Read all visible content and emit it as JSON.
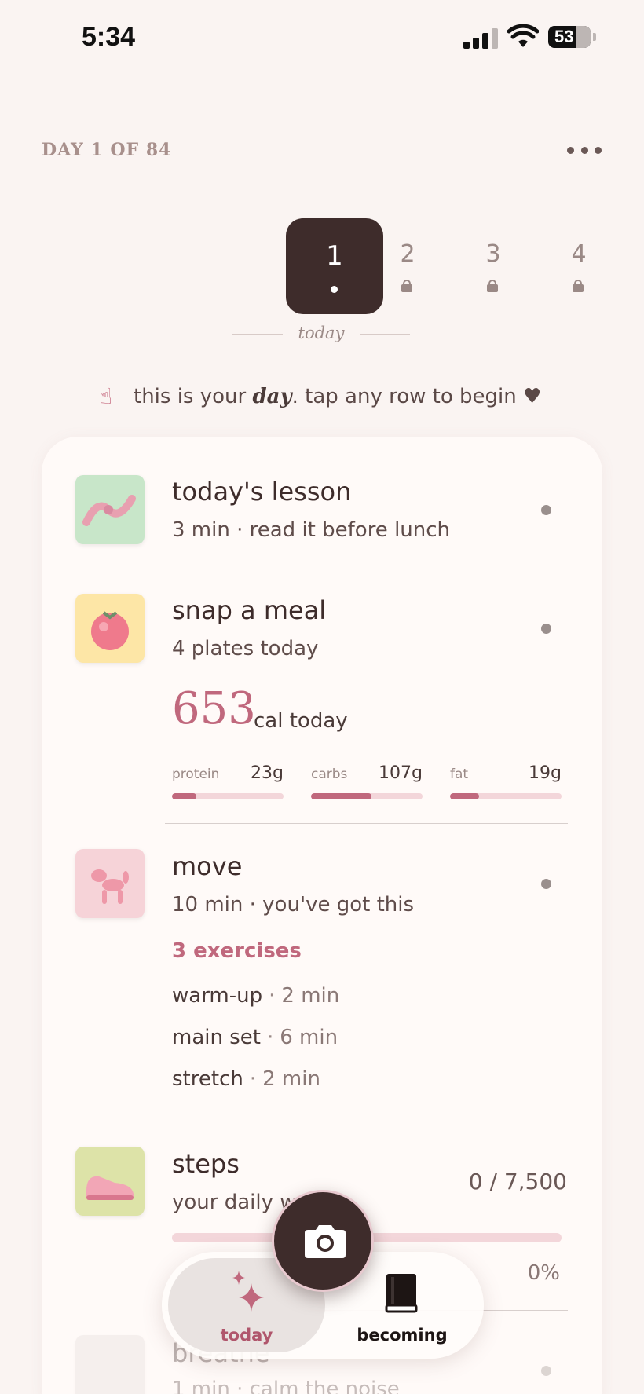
{
  "status_bar": {
    "time": "5:34",
    "battery": "53"
  },
  "header": {
    "day_label": "DAY 1 OF 84"
  },
  "days": [
    {
      "number": "1",
      "state": "active"
    },
    {
      "number": "2",
      "state": "locked"
    },
    {
      "number": "3",
      "state": "locked"
    },
    {
      "number": "4",
      "state": "locked"
    }
  ],
  "today_caption": "today",
  "hint": {
    "before": "this is your",
    "emphasis": "day",
    "after": ". tap any row to begin ♥"
  },
  "rows": {
    "lesson": {
      "title": "today's lesson",
      "subtitle": "3 min · read it before lunch",
      "icon": "bow-icon"
    },
    "meal": {
      "title": "snap a meal",
      "subtitle": "4 plates today",
      "icon": "tomato-icon",
      "calories": "653",
      "calories_unit": "cal today",
      "macros": [
        {
          "label": "protein",
          "value": "23g",
          "progress": 0.22
        },
        {
          "label": "carbs",
          "value": "107g",
          "progress": 0.54
        },
        {
          "label": "fat",
          "value": "19g",
          "progress": 0.26
        }
      ]
    },
    "move": {
      "title": "move",
      "subtitle": "10 min · you've got this",
      "icon": "balloon-dog-icon",
      "exercise_count": "3 exercises",
      "exercises": [
        {
          "name": "warm-up",
          "duration": "2 min"
        },
        {
          "name": "main set",
          "duration": "6 min"
        },
        {
          "name": "stretch",
          "duration": "2 min"
        }
      ]
    },
    "steps": {
      "title": "steps",
      "subtitle": "your daily w",
      "icon": "shoe-icon",
      "count": "0 / 7,500",
      "percent": "0%",
      "progress": 0
    },
    "breathe": {
      "title": "breathe",
      "subtitle": "1 min · calm the noise"
    }
  },
  "nav": {
    "today_label": "today",
    "becoming_label": "becoming"
  },
  "colors": {
    "accent": "#c0687d",
    "dark": "#3e2c2b",
    "background": "#faf4f2",
    "track": "#f3d6da"
  }
}
